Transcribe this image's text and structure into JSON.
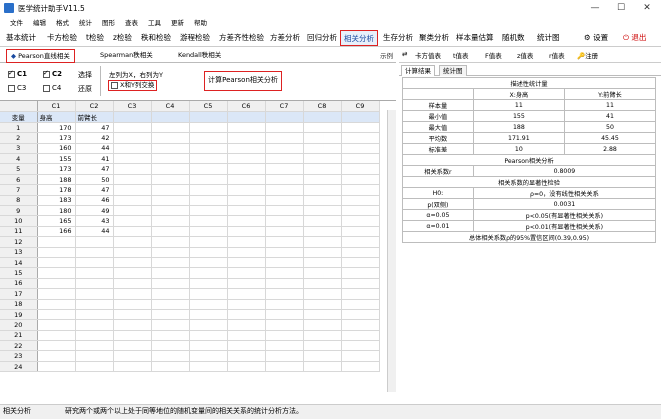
{
  "window": {
    "title": "医学统计助手V11.5"
  },
  "menu": [
    "文件",
    "编辑",
    "格式",
    "统计",
    "图形",
    "查表",
    "工具",
    "更新",
    "帮助"
  ],
  "tabs": [
    {
      "label": "基本统计"
    },
    {
      "label": "卡方检验"
    },
    {
      "label": "t检验"
    },
    {
      "label": "z检验"
    },
    {
      "label": "秩和检验"
    },
    {
      "label": "游程检验"
    },
    {
      "label": "方差齐性检验"
    },
    {
      "label": "方差分析"
    },
    {
      "label": "回归分析"
    },
    {
      "label": "相关分析"
    },
    {
      "label": "生存分析"
    },
    {
      "label": "聚类分析"
    },
    {
      "label": "样本量估算"
    },
    {
      "label": "随机数"
    },
    {
      "label": "统计图"
    }
  ],
  "toolbar": {
    "settings": "设置",
    "exit": "退出"
  },
  "subtabs": {
    "pearson": "Pearson直线相关",
    "spearman": "Spearman秩相关",
    "kendall": "Kendall秩相关",
    "example": "示例"
  },
  "options": {
    "c1": "C1",
    "c2": "C2",
    "c3": "C3",
    "c4": "C4",
    "select": "选择",
    "restore": "还原",
    "swap_hint": "左列为X，右列为Y",
    "swap_label": "X和Y列交换",
    "calc_button": "计算Pearson相关分析"
  },
  "sheet": {
    "columns": [
      "C1",
      "C2",
      "C3",
      "C4",
      "C5",
      "C6",
      "C7",
      "C8",
      "C9"
    ],
    "var_label": "变量",
    "names": [
      "身高",
      "前臂长"
    ],
    "rows": [
      [
        "170",
        "47"
      ],
      [
        "173",
        "42"
      ],
      [
        "160",
        "44"
      ],
      [
        "155",
        "41"
      ],
      [
        "173",
        "47"
      ],
      [
        "188",
        "50"
      ],
      [
        "178",
        "47"
      ],
      [
        "183",
        "46"
      ],
      [
        "180",
        "49"
      ],
      [
        "165",
        "43"
      ],
      [
        "166",
        "44"
      ]
    ],
    "total_rows": 24
  },
  "right_toolbar": {
    "chi": "卡方值表",
    "t": "t值表",
    "f": "F值表",
    "z": "z值表",
    "r": "r值表",
    "register": "注册"
  },
  "right_tabs": {
    "results": "计算结果",
    "chart": "统计图"
  },
  "results": {
    "desc_title": "描述性统计量",
    "col_x": "X:身高",
    "col_y": "Y:前臂长",
    "desc_rows": [
      {
        "label": "样本量",
        "x": "11",
        "y": "11"
      },
      {
        "label": "最小值",
        "x": "155",
        "y": "41"
      },
      {
        "label": "最大值",
        "x": "188",
        "y": "50"
      },
      {
        "label": "平均数",
        "x": "171.91",
        "y": "45.45"
      },
      {
        "label": "标准差",
        "x": "10",
        "y": "2.88"
      }
    ],
    "pearson_title": "Pearson相关分析",
    "r_label": "相关系数r",
    "r_value": "0.8009",
    "sig_title": "相关系数的显著性检验",
    "h0_label": "H0:",
    "h0_text": "ρ=0，没有线性相关关系",
    "p_label": "p(双侧)",
    "p_value": "0.0031",
    "a05_label": "α=0.05",
    "a05_text": "p<0.05(有显著性相关关系)",
    "a01_label": "α=0.01",
    "a01_text": "p<0.01(有显著性相关关系)",
    "ci_text": "总体相关系数ρ的95%置信区间(0.39,0.95)"
  },
  "status": {
    "left": "相关分析",
    "message": "研究两个或两个以上处于同等地位的随机变量间的相关关系的统计分析方法。"
  }
}
